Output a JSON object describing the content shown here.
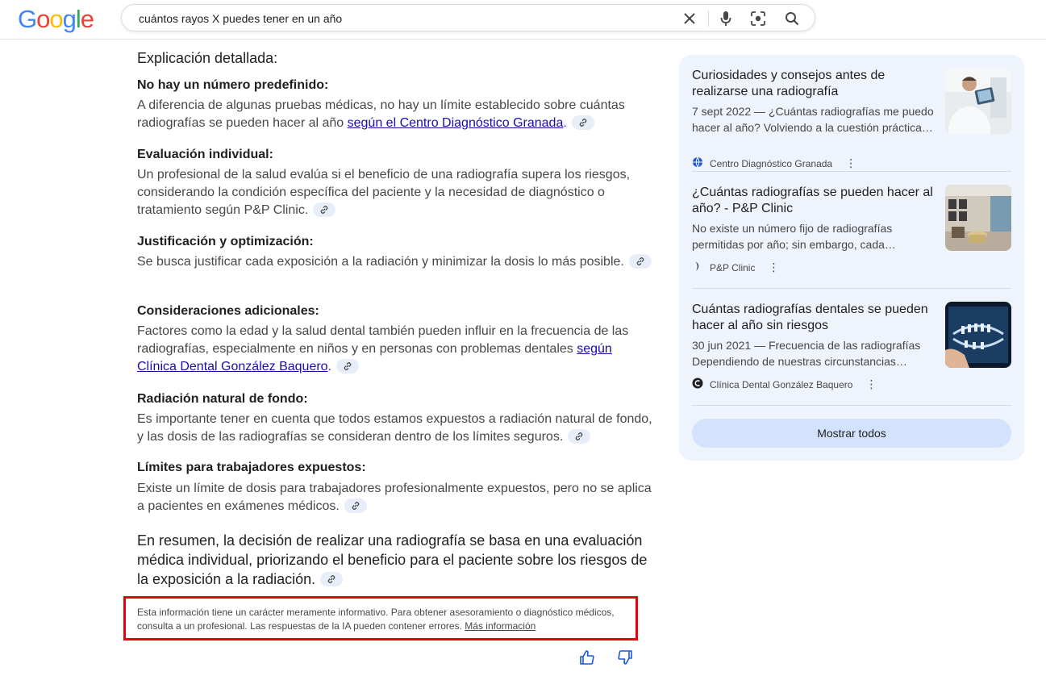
{
  "header": {
    "logo_letters": [
      {
        "char": "G",
        "color": "#4285F4"
      },
      {
        "char": "o",
        "color": "#EA4335"
      },
      {
        "char": "o",
        "color": "#FBBC05"
      },
      {
        "char": "g",
        "color": "#4285F4"
      },
      {
        "char": "l",
        "color": "#34A853"
      },
      {
        "char": "e",
        "color": "#EA4335"
      }
    ],
    "search_query": "cuántos rayos X puedes tener en un año",
    "icons": [
      "close-icon",
      "microphone-icon",
      "lens-icon",
      "search-icon"
    ]
  },
  "overview": {
    "heading": "Explicación detallada:",
    "sections": [
      {
        "title": "No hay un número predefinido:",
        "text": "A diferencia de algunas pruebas médicas, no hay un límite establecido sobre cuántas radiografías se pueden hacer al año ",
        "link": "según el Centro Diagnóstico Granada",
        "after": "."
      },
      {
        "title": "Evaluación individual:",
        "text": "Un profesional de la salud evalúa si el beneficio de una radiografía supera los riesgos, considerando la condición específica del paciente y la necesidad de diagnóstico o tratamiento según P&P Clinic.",
        "link": "",
        "after": ""
      },
      {
        "title": "Justificación y optimización:",
        "text": "Se busca justificar cada exposición a la radiación y minimizar la dosis lo más posible.",
        "link": "",
        "after": ""
      },
      {
        "title": "Consideraciones adicionales:",
        "text": "Factores como la edad y la salud dental también pueden influir en la frecuencia de las radiografías, especialmente en niños y en personas con problemas dentales ",
        "link": "según Clínica Dental González Baquero",
        "after": "."
      },
      {
        "title": "Radiación natural de fondo:",
        "text": "Es importante tener en cuenta que todos estamos expuestos a radiación natural de fondo, y las dosis de las radiografías se consideran dentro de los límites seguros.",
        "link": "",
        "after": ""
      },
      {
        "title": "Límites para trabajadores expuestos:",
        "text": "Existe un límite de dosis para trabajadores profesionalmente expuestos, pero no se aplica a pacientes en exámenes médicos.",
        "link": "",
        "after": ""
      }
    ],
    "summary": "En resumen, la decisión de realizar una radiografía se basa en una evaluación médica individual, priorizando el beneficio para el paciente sobre los riesgos de la exposición a la radiación.",
    "disclaimer": "Esta información tiene un carácter meramente informativo. Para obtener asesoramiento o diagnóstico médicos, consulta a un profesional. Las respuestas de la IA pueden contener errores.",
    "disclaimer_link": "Más información",
    "feedback_icons": [
      "thumbs-up-icon",
      "thumbs-down-icon"
    ]
  },
  "sources": {
    "cards": [
      {
        "title": "Curiosidades y consejos antes de realizarse una radiografía",
        "snippet": "7 sept 2022 — ¿Cuántas radiografías me puedo hacer al año? Volviendo a la cuestión práctica…",
        "source": "Centro Diagnóstico Granada",
        "source_icon": "globe-icon"
      },
      {
        "title": "¿Cuántas radiografías se pueden hacer al año? - P&P Clinic",
        "snippet": "No existe un número fijo de radiografías permitidas por año; sin embargo, cada…",
        "source": "P&P Clinic",
        "source_icon": "pp-clinic-logo-icon"
      },
      {
        "title": "Cuántas radiografías dentales se pueden hacer al año sin riesgos",
        "snippet": "30 jun 2021 — Frecuencia de las radiografías Dependiendo de nuestras circunstancias…",
        "source": "Clínica Dental González Baquero",
        "source_icon": "gonzalez-baquero-logo-icon"
      }
    ],
    "show_all": "Mostrar todos"
  },
  "colors": {
    "link": "#1a0dab",
    "panel_bg": "#eef3fc",
    "show_all_bg": "#d3e3fd",
    "highlight_border": "#e8000a"
  }
}
